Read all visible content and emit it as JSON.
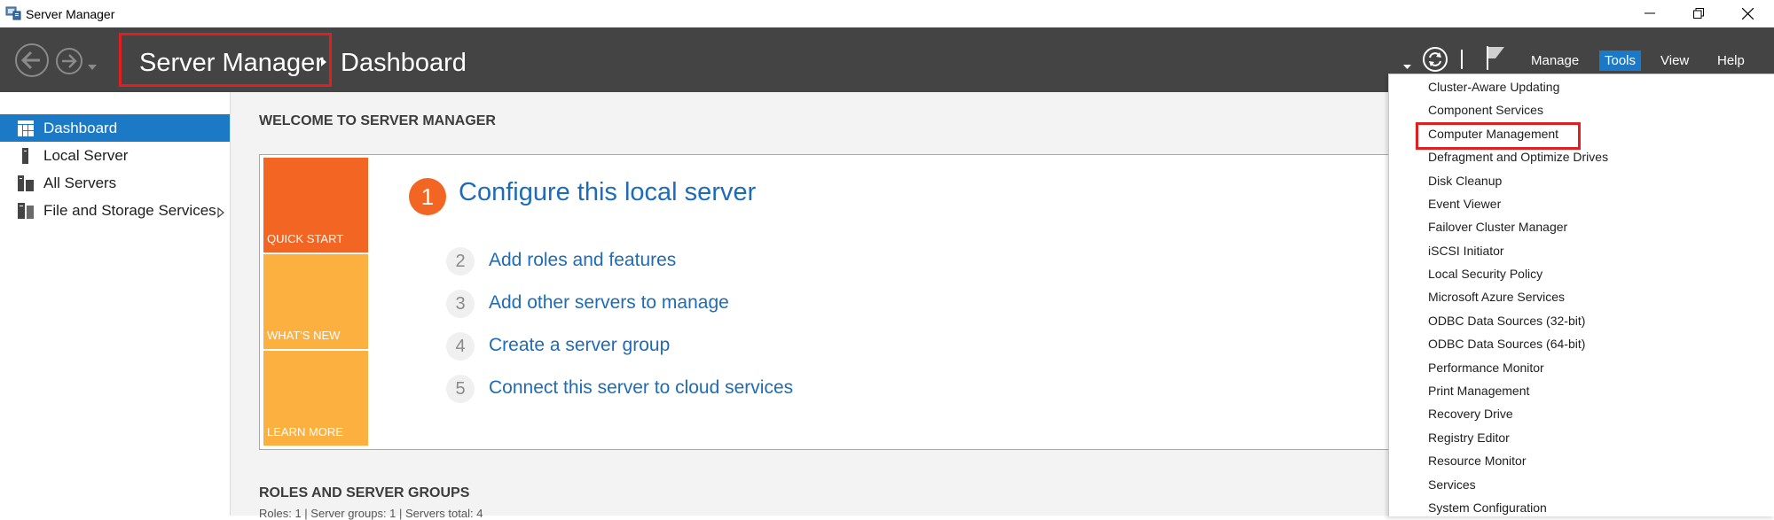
{
  "window": {
    "title": "Server Manager",
    "icon": "server-manager-icon"
  },
  "header": {
    "breadcrumb_root": "Server Manager",
    "breadcrumb_current": "Dashboard",
    "menus": {
      "manage": "Manage",
      "tools": "Tools",
      "view": "View",
      "help": "Help"
    },
    "active_menu": "Tools"
  },
  "sidebar": {
    "items": [
      {
        "label": "Dashboard",
        "icon": "dashboard-icon",
        "active": true
      },
      {
        "label": "Local Server",
        "icon": "local-server-icon",
        "active": false
      },
      {
        "label": "All Servers",
        "icon": "all-servers-icon",
        "active": false
      },
      {
        "label": "File and Storage Services",
        "icon": "storage-icon",
        "active": false
      }
    ]
  },
  "main": {
    "welcome_title": "WELCOME TO SERVER MANAGER",
    "tiles": {
      "quick_start": "QUICK START",
      "whats_new": "WHAT'S NEW",
      "learn_more": "LEARN MORE"
    },
    "steps": [
      {
        "number": "1",
        "text": "Configure this local server"
      },
      {
        "number": "2",
        "text": "Add roles and features"
      },
      {
        "number": "3",
        "text": "Add other servers to manage"
      },
      {
        "number": "4",
        "text": "Create a server group"
      },
      {
        "number": "5",
        "text": "Connect this server to cloud services"
      }
    ],
    "roles_title": "ROLES AND SERVER GROUPS",
    "roles_summary": "Roles: 1   |   Server groups: 1   |   Servers total: 4"
  },
  "tools_menu": {
    "items": [
      "Cluster-Aware Updating",
      "Component Services",
      "Computer Management",
      "Defragment and Optimize Drives",
      "Disk Cleanup",
      "Event Viewer",
      "Failover Cluster Manager",
      "iSCSI Initiator",
      "Local Security Policy",
      "Microsoft Azure Services",
      "ODBC Data Sources (32-bit)",
      "ODBC Data Sources (64-bit)",
      "Performance Monitor",
      "Print Management",
      "Recovery Drive",
      "Registry Editor",
      "Resource Monitor",
      "Services",
      "System Configuration"
    ],
    "highlighted": "Computer Management"
  },
  "colors": {
    "header_bg": "#444444",
    "accent_blue": "#1c79c6",
    "quick_start_orange": "#f26522",
    "tile_amber": "#fbb040",
    "link_blue": "#1e6bb8",
    "highlight_red": "#e02020"
  }
}
